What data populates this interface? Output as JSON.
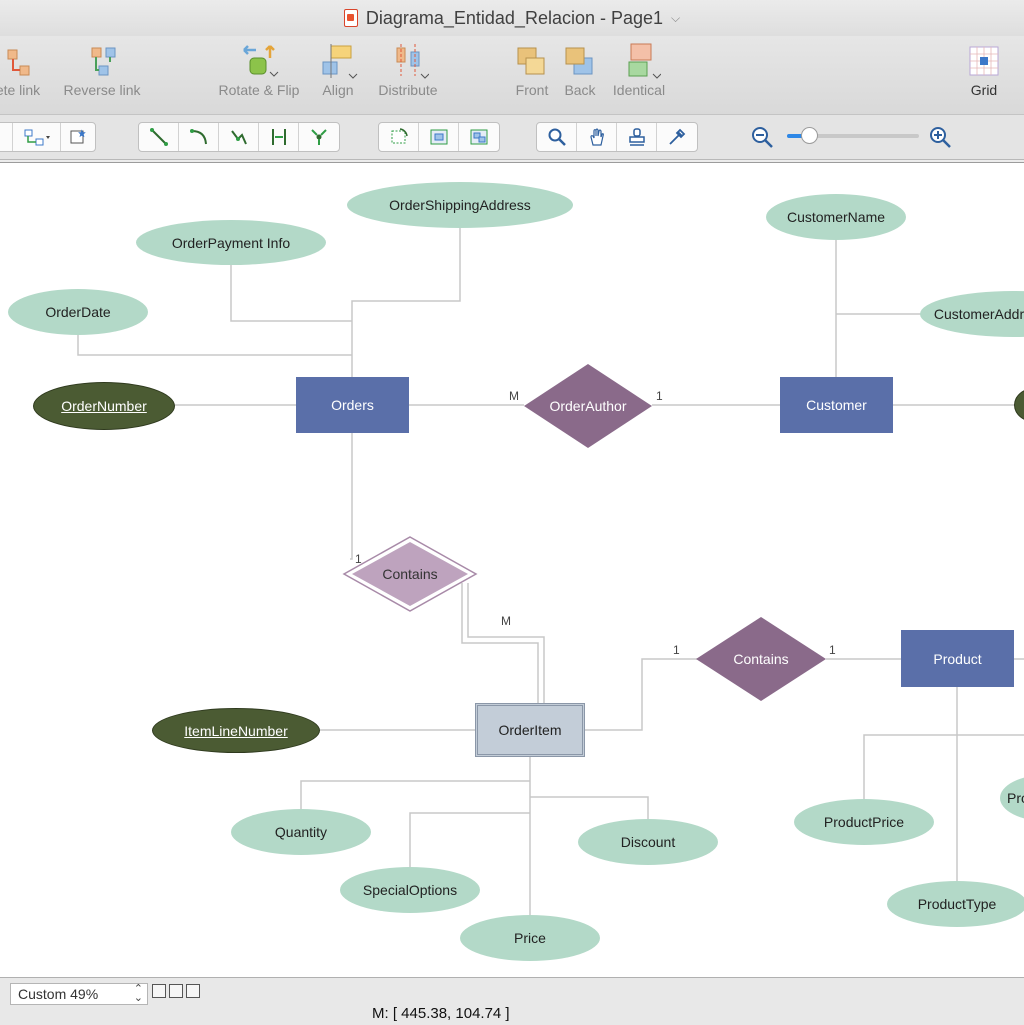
{
  "window": {
    "title": "Diagrama_Entidad_Relacion - Page1"
  },
  "toolbar": {
    "delete_link": "ete link",
    "reverse_link": "Reverse link",
    "rotate_flip": "Rotate & Flip",
    "align": "Align",
    "distribute": "Distribute",
    "front": "Front",
    "back": "Back",
    "identical": "Identical",
    "grid": "Grid"
  },
  "zoom": {
    "value": 0.17,
    "level_label": "Custom 49%"
  },
  "status": {
    "coords": "M: [ 445.38, 104.74 ]"
  },
  "colors": {
    "attribute": "#b3d9c8",
    "key_attribute": "#4b5b33",
    "entity": "#5a6fa9",
    "weak_entity": "#c3cdd8",
    "relationship": "#8a6a8a",
    "weak_relationship": "#bea3be",
    "connector": "#c8c8c8",
    "accent": "#2d87e6"
  },
  "diagram": {
    "entities": {
      "orders": "Orders",
      "customer": "Customer",
      "product": "Product",
      "order_item": "OrderItem"
    },
    "relationships": {
      "order_author": "OrderAuthor",
      "contains_order": "Contains",
      "contains_product": "Contains"
    },
    "attributes": {
      "order_shipping_address": "OrderShippingAddress",
      "order_payment_info": "OrderPayment Info",
      "order_date": "OrderDate",
      "order_number": "OrderNumber",
      "customer_name": "CustomerName",
      "customer_address": "CustomerAddr",
      "item_line_number": "ItemLineNumber",
      "quantity": "Quantity",
      "special_options": "SpecialOptions",
      "price": "Price",
      "discount": "Discount",
      "product_price": "ProductPrice",
      "product_type": "ProductType",
      "product_partial": "Pro"
    },
    "cardinality": {
      "orders_author": "M",
      "author_customer": "1",
      "orders_contains": "1",
      "contains_item": "M",
      "item_contains": "1",
      "contains_product": "1"
    }
  }
}
